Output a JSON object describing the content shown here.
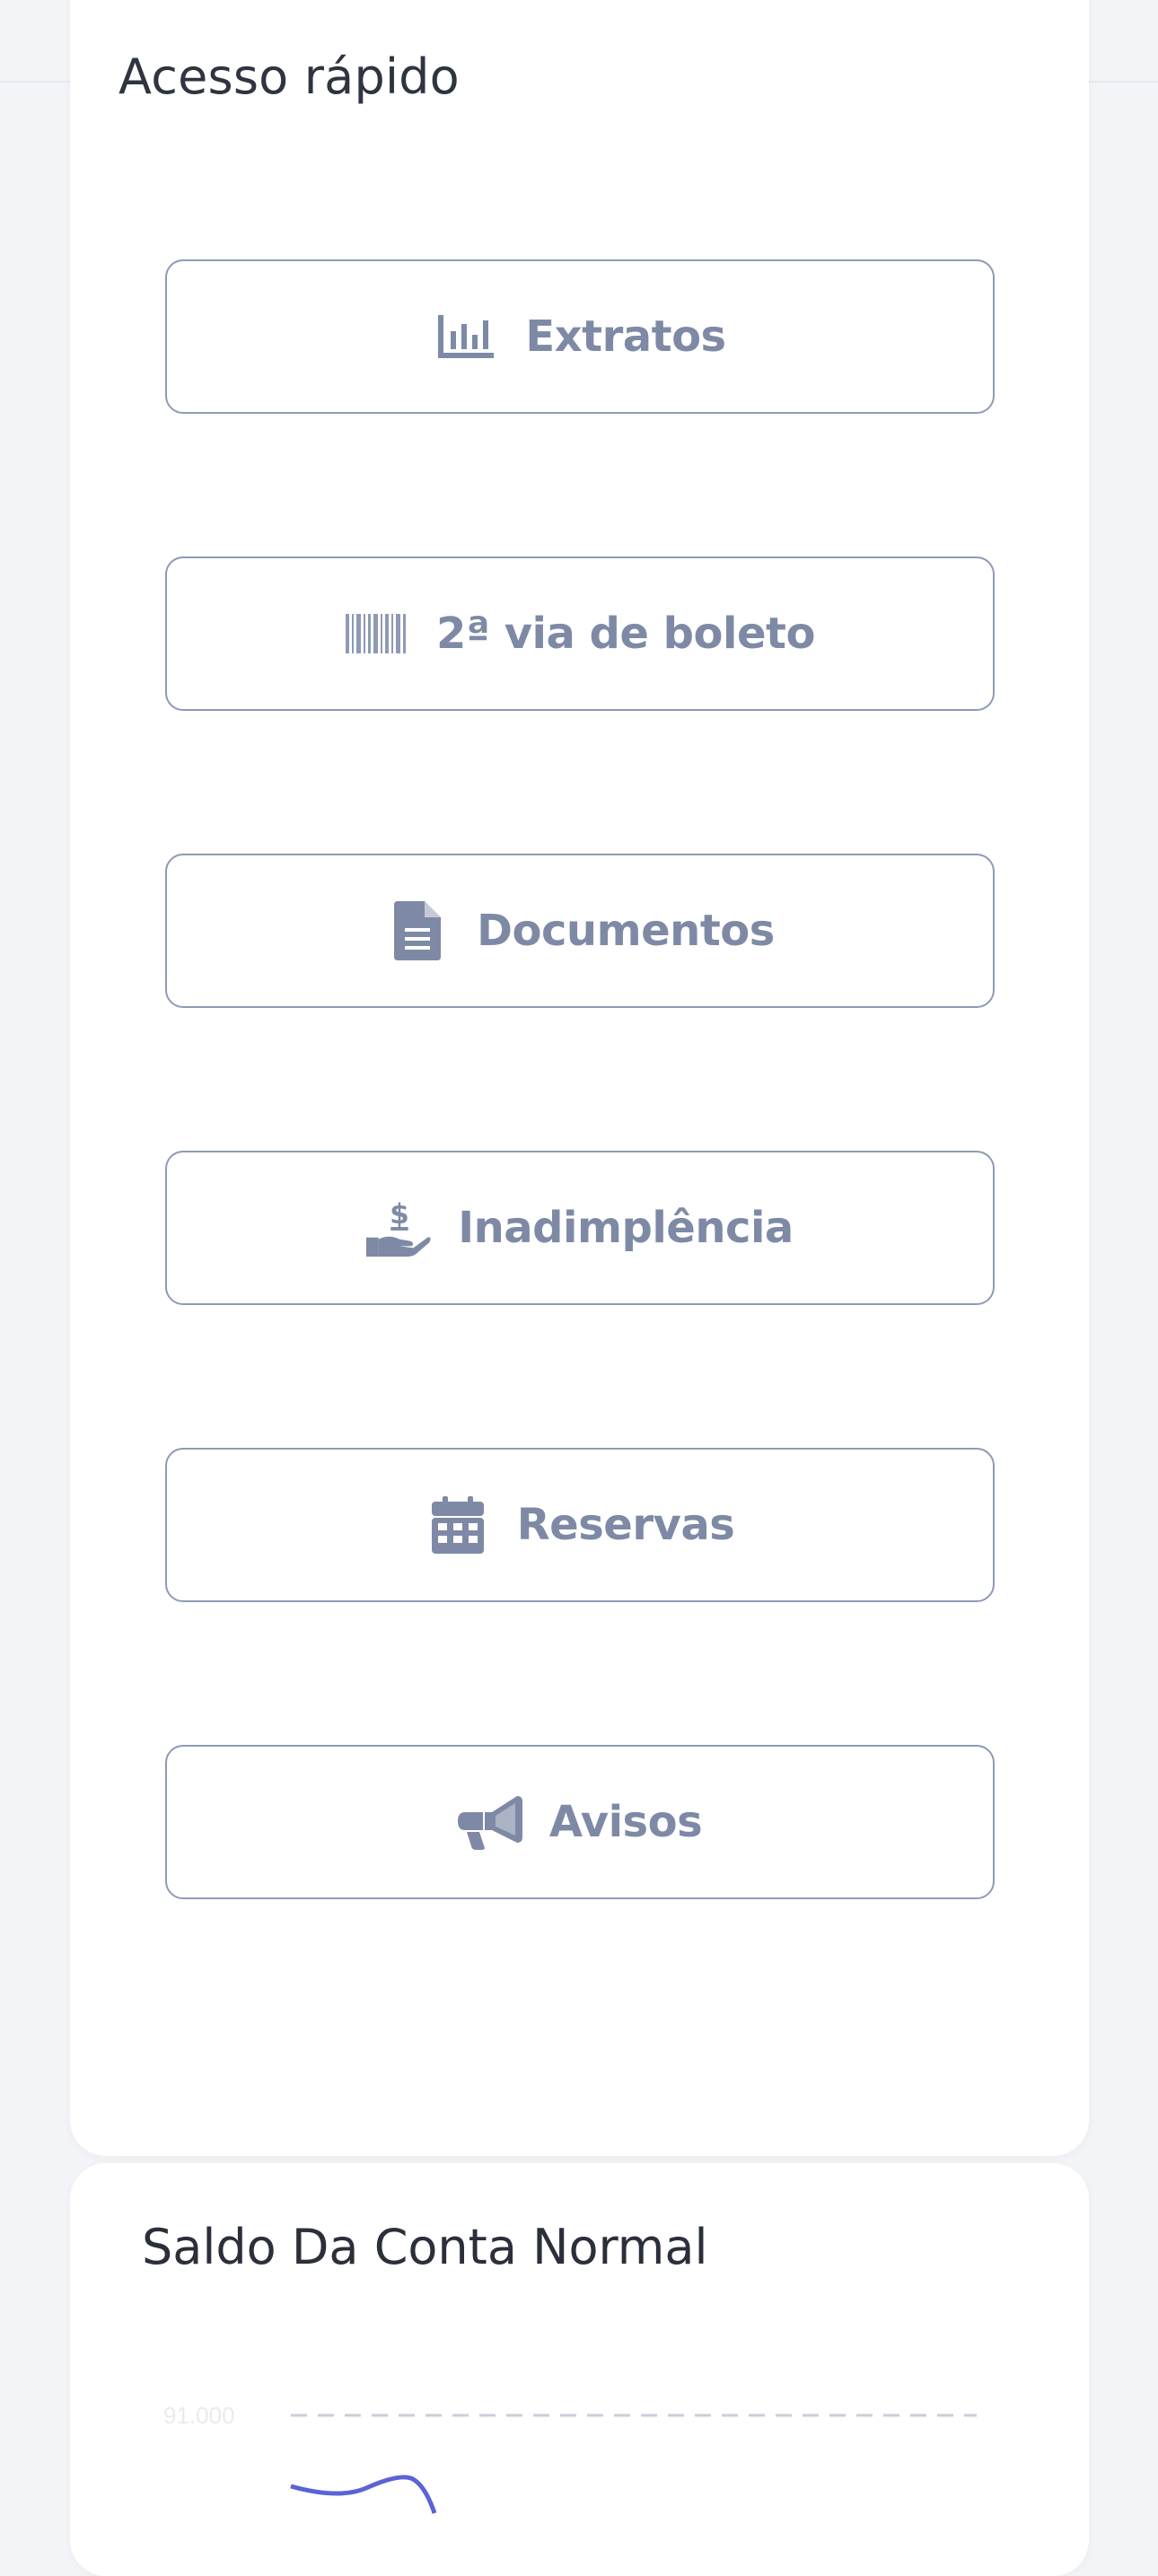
{
  "quick_access": {
    "title": "Acesso rápido",
    "buttons": [
      {
        "label": "Extratos",
        "icon": "chart-bar-icon"
      },
      {
        "label": "2ª via de boleto",
        "icon": "barcode-icon"
      },
      {
        "label": "Documentos",
        "icon": "file-document-icon"
      },
      {
        "label": "Inadimplência",
        "icon": "hand-money-icon"
      },
      {
        "label": "Reservas",
        "icon": "calendar-icon"
      },
      {
        "label": "Avisos",
        "icon": "megaphone-icon"
      }
    ]
  },
  "balance": {
    "title": "Saldo Da Conta Normal",
    "y_tick_label": "91.000"
  },
  "colors": {
    "button_border": "#8e9ab5",
    "button_text": "#7e8aa5",
    "chart_line": "#5b63d6",
    "background": "#f3f4f7"
  }
}
